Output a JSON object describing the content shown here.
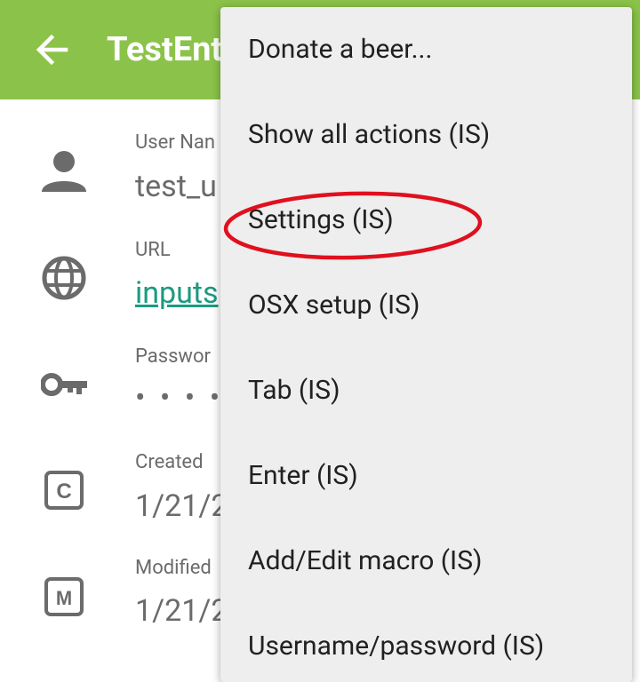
{
  "app_bar": {
    "title": "TestEnt",
    "color": "#8bc34a",
    "back_icon": "arrow-left-icon"
  },
  "fields": [
    {
      "icon": "person-icon",
      "label": "User Nan",
      "value": "test_u"
    },
    {
      "icon": "globe-icon",
      "label": "URL",
      "value": "inputs"
    },
    {
      "icon": "key-icon",
      "label": "Passwor",
      "value": "• • • •"
    },
    {
      "icon": "created-c-icon",
      "label": "Created",
      "value": "1/21/2"
    },
    {
      "icon": "modified-m-icon",
      "label": "Modified",
      "value": "1/21/2"
    }
  ],
  "menu": {
    "items": [
      "Donate a beer...",
      "Show all actions (IS)",
      "Settings (IS)",
      "OSX setup (IS)",
      "Tab (IS)",
      "Enter (IS)",
      "Add/Edit macro (IS)",
      "Username/password (IS)"
    ],
    "highlighted_item": "Settings (IS)",
    "highlight_color": "#e0101e"
  }
}
